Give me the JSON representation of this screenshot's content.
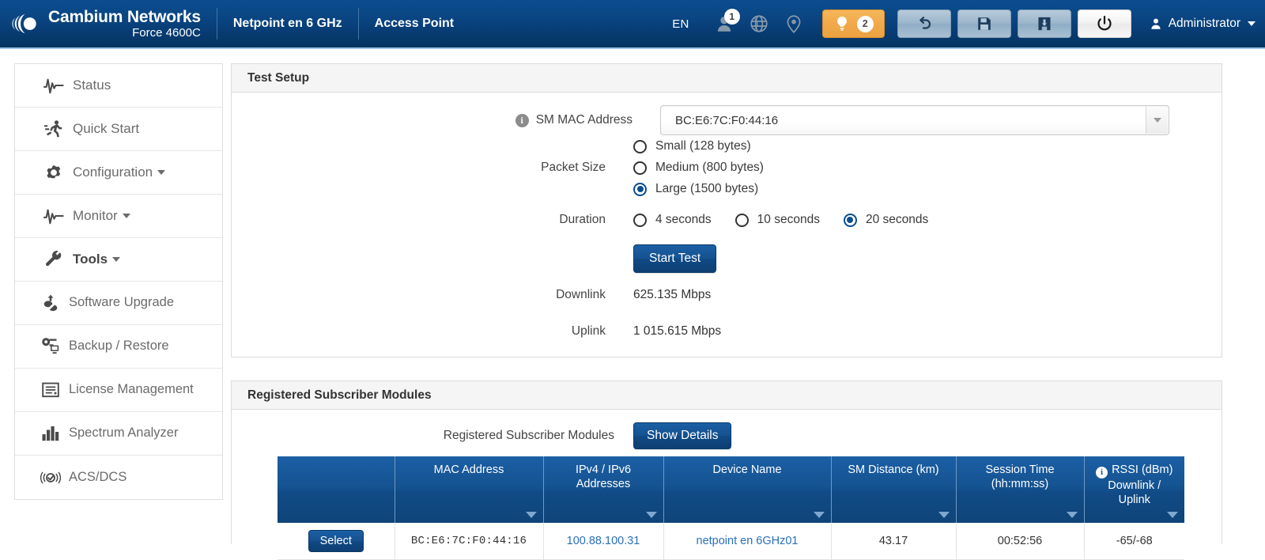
{
  "header": {
    "brand_name": "Cambium Networks",
    "brand_model": "Force 4600C",
    "device_name": "Netpoint en 6 GHz",
    "device_role": "Access Point",
    "language": "EN",
    "user_badge_count": "1",
    "tips_count": "2",
    "account_label": "Administrator",
    "icons": {
      "user": "user-icon",
      "globe": "globe-icon",
      "location": "location-pin-icon",
      "bulb": "lightbulb-icon",
      "undo": "undo-icon",
      "save": "floppy-disk-save-icon",
      "export": "export-icon",
      "power": "power-icon",
      "account": "account-avatar-icon"
    },
    "accent_blue": "#0b4d8f",
    "accent_orange": "#f0a94a"
  },
  "sidebar": {
    "items": [
      {
        "label": "Status",
        "icon": "pulse-icon",
        "expandable": false
      },
      {
        "label": "Quick Start",
        "icon": "runner-icon",
        "expandable": false
      },
      {
        "label": "Configuration",
        "icon": "gear-icon",
        "expandable": true
      },
      {
        "label": "Monitor",
        "icon": "pulse-icon",
        "expandable": true
      },
      {
        "label": "Tools",
        "icon": "wrench-icon",
        "expandable": true,
        "active": true
      }
    ],
    "sub_items": [
      {
        "label": "Software Upgrade",
        "icon": "upload-cloud-icon"
      },
      {
        "label": "Backup / Restore",
        "icon": "backup-restore-icon"
      },
      {
        "label": "License Management",
        "icon": "license-document-icon"
      },
      {
        "label": "Spectrum Analyzer",
        "icon": "bar-chart-icon"
      },
      {
        "label": "ACS/DCS",
        "icon": "acs-dcs-icon"
      }
    ]
  },
  "test_setup": {
    "title": "Test Setup",
    "mac_label": "SM MAC Address",
    "mac_value": "BC:E6:7C:F0:44:16",
    "packet_size_label": "Packet Size",
    "packet_size_options": [
      {
        "label": "Small (128 bytes)",
        "selected": false
      },
      {
        "label": "Medium (800 bytes)",
        "selected": false
      },
      {
        "label": "Large (1500 bytes)",
        "selected": true
      }
    ],
    "duration_label": "Duration",
    "duration_options": [
      {
        "label": "4 seconds",
        "selected": false
      },
      {
        "label": "10 seconds",
        "selected": false
      },
      {
        "label": "20 seconds",
        "selected": true
      }
    ],
    "start_button": "Start Test",
    "downlink_label": "Downlink",
    "downlink_value": "625.135 Mbps",
    "uplink_label": "Uplink",
    "uplink_value": "1 015.615 Mbps"
  },
  "registered_modules": {
    "title": "Registered Subscriber Modules",
    "inline_label": "Registered Subscriber Modules",
    "show_details_button": "Show Details",
    "columns": [
      {
        "line1": "",
        "line2": "",
        "sortable": false,
        "info": false
      },
      {
        "line1": "MAC Address",
        "line2": "",
        "sortable": true,
        "info": false
      },
      {
        "line1": "IPv4 / IPv6 Addresses",
        "line2": "",
        "sortable": true,
        "info": false
      },
      {
        "line1": "Device Name",
        "line2": "",
        "sortable": true,
        "info": false
      },
      {
        "line1": "SM Distance (km)",
        "line2": "",
        "sortable": true,
        "info": false
      },
      {
        "line1": "Session Time",
        "line2": "(hh:mm:ss)",
        "sortable": true,
        "info": false
      },
      {
        "line1": "RSSI (dBm)",
        "line2": "Downlink / Uplink",
        "sortable": true,
        "info": true
      }
    ],
    "rows": [
      {
        "select_label": "Select",
        "mac": "BC:E6:7C:F0:44:16",
        "ip": "100.88.100.31",
        "device_name": "netpoint en 6GHz01",
        "distance": "43.17",
        "session_time": "00:52:56",
        "rssi": "-65/-68"
      }
    ]
  }
}
